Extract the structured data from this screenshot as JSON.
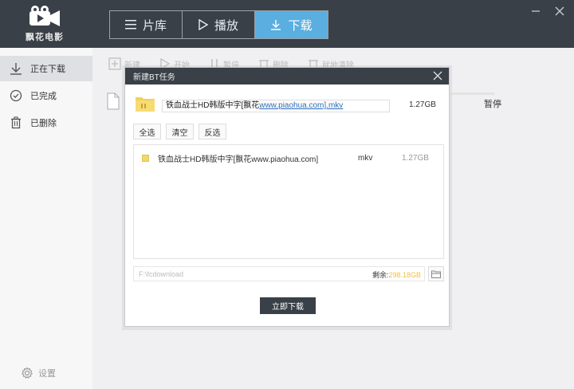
{
  "app": {
    "logo_text": "飘花电影"
  },
  "tabs": [
    {
      "label": "片库",
      "icon": "menu-icon"
    },
    {
      "label": "播放",
      "icon": "play-icon"
    },
    {
      "label": "下载",
      "icon": "download-icon"
    }
  ],
  "sidebar": {
    "items": [
      {
        "label": "正在下载",
        "icon": "download-arrow-icon"
      },
      {
        "label": "已完成",
        "icon": "check-circle-icon"
      },
      {
        "label": "已删除",
        "icon": "trash-icon"
      }
    ],
    "settings_label": "设置"
  },
  "toolbar": {
    "new_label": "新建",
    "start_label": "开始",
    "pause_label": "暂停",
    "delete_label": "删除",
    "clear_label": "就地清除"
  },
  "task_row": {
    "status": "暂停"
  },
  "dialog": {
    "title": "新建BT任务",
    "name_prefix": "铁血战士HD韩版中字[飘花",
    "name_link": "www.piaohua.com].mkv",
    "total_size": "1.27GB",
    "select_all": "全选",
    "clear": "清空",
    "invert": "反选",
    "files": [
      {
        "name": "铁血战士HD韩版中字[飘花www.piaohua.com]",
        "ext": "mkv",
        "size": "1.27GB"
      }
    ],
    "path_placeholder": "F:\\fcdownload",
    "remain_label": "剩余:",
    "remain_value": "298.18GB",
    "download_button": "立即下载"
  },
  "colors": {
    "topbar": "#3a4048",
    "tab_active": "#5aaee0",
    "link": "#2b6cb5",
    "checkbox": "#f2d76a"
  }
}
